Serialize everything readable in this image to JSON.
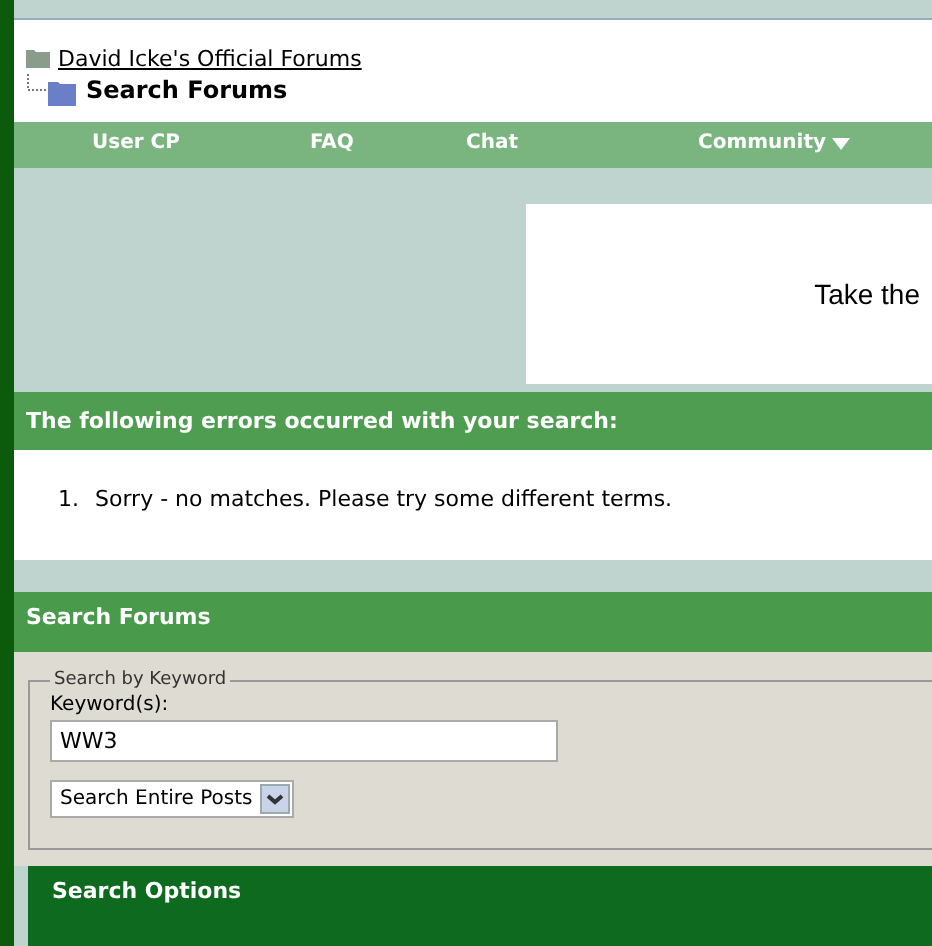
{
  "breadcrumb": {
    "parent": "David Icke's Official Forums",
    "current": "Search Forums"
  },
  "navbar": [
    {
      "label": "User CP",
      "dropdown": false
    },
    {
      "label": "FAQ",
      "dropdown": false
    },
    {
      "label": "Chat",
      "dropdown": false
    },
    {
      "label": "Community",
      "dropdown": true
    }
  ],
  "banner": {
    "text": "Take the"
  },
  "errors": {
    "title": "The following errors occurred with your search:",
    "items": [
      {
        "marker": "1.",
        "text": "Sorry - no matches. Please try some different terms."
      }
    ]
  },
  "search": {
    "title": "Search Forums",
    "legend": "Search by Keyword",
    "label": "Keyword(s):",
    "value": "WW3",
    "mode": "Search Entire Posts"
  },
  "options": {
    "title": "Search Options"
  }
}
